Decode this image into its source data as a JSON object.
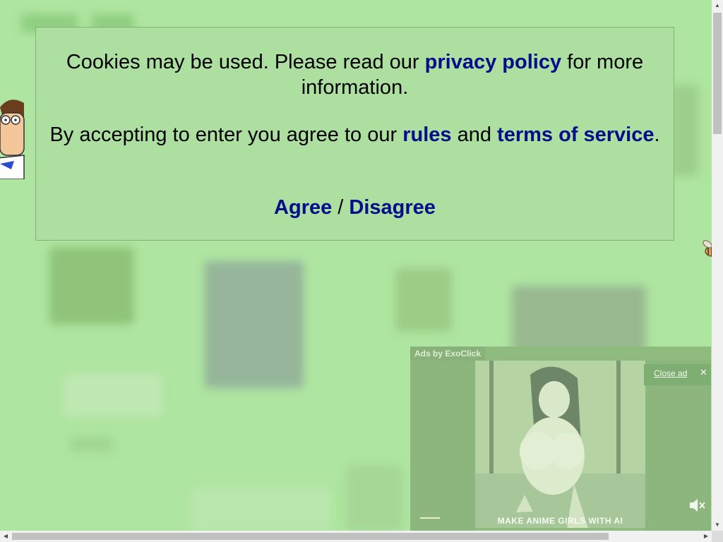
{
  "cookie_notice": {
    "line1_before": "Cookies may be used. Please read our ",
    "privacy_link": "privacy policy",
    "line1_after": " for more information.",
    "line2_before": "By accepting to enter you agree to our ",
    "rules_link": "rules",
    "line2_middle": " and ",
    "terms_link": "terms of service",
    "line2_after": ".",
    "agree": "Agree",
    "separator": " / ",
    "disagree": "Disagree"
  },
  "ad": {
    "label": "Ads by ExoClick",
    "close_label": "Close ad",
    "close_x": "✕",
    "caption": "MAKE ANIME GIRLS WITH AI"
  },
  "scrollbars": {
    "up": "▲",
    "down": "▼",
    "left": "◀",
    "right": "▶"
  },
  "colors": {
    "background": "#aee5a0",
    "link": "#000c8a",
    "modal": "#acdfa0"
  }
}
